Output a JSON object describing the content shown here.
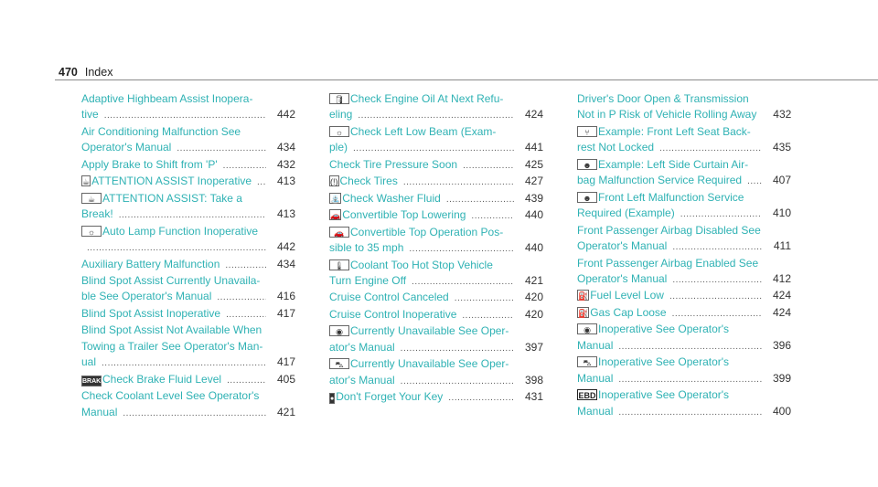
{
  "header": {
    "page_number": "470",
    "section": "Index"
  },
  "columns": [
    [
      {
        "icon": null,
        "lines": [
          "Adaptive Highbeam Assist Inopera-",
          "tive"
        ],
        "page": "442"
      },
      {
        "icon": null,
        "lines": [
          "Air Conditioning Malfunction See",
          "Operator's Manual"
        ],
        "page": "434"
      },
      {
        "icon": null,
        "lines": [
          "Apply Brake to Shift from 'P'"
        ],
        "page": "432"
      },
      {
        "icon": "coffee-cup-icon",
        "glyph": "☕",
        "lines": [
          "ATTENTION ASSIST Inoperative"
        ],
        "page": "413"
      },
      {
        "icon": "coffee-cup-icon",
        "glyph": "☕",
        "lines": [
          "ATTENTION ASSIST: Take a",
          "Break!"
        ],
        "page": "413"
      },
      {
        "icon": "lamp-icon",
        "glyph": "☼",
        "lines": [
          "Auto Lamp Function Inoperative",
          ""
        ],
        "page": "442"
      },
      {
        "icon": null,
        "lines": [
          "Auxiliary Battery Malfunction"
        ],
        "page": "434"
      },
      {
        "icon": null,
        "lines": [
          "Blind Spot Assist Currently Unavaila-",
          "ble See Operator's Manual"
        ],
        "page": "416"
      },
      {
        "icon": null,
        "lines": [
          "Blind Spot Assist Inoperative"
        ],
        "page": "417"
      },
      {
        "icon": null,
        "lines": [
          "Blind Spot Assist Not Available When",
          "Towing a Trailer See Operator's Man-",
          "ual"
        ],
        "page": "417"
      },
      {
        "icon": "brake-icon",
        "glyph": "BRAKE",
        "lines": [
          "Check Brake Fluid Level"
        ],
        "page": "405"
      },
      {
        "icon": null,
        "lines": [
          "Check Coolant Level See Operator's",
          "Manual"
        ],
        "page": "421"
      }
    ],
    [
      {
        "icon": "oil-can-icon",
        "glyph": "🛢",
        "lines": [
          "Check Engine Oil At Next Refu-",
          "eling"
        ],
        "page": "424"
      },
      {
        "icon": "lamp-icon",
        "glyph": "☼",
        "lines": [
          "Check Left Low Beam (Exam-",
          "ple)"
        ],
        "page": "441"
      },
      {
        "icon": null,
        "lines": [
          "Check Tire Pressure Soon"
        ],
        "page": "425"
      },
      {
        "icon": "tire-pressure-icon",
        "glyph": "(!)",
        "lines": [
          "Check Tires"
        ],
        "page": "427"
      },
      {
        "icon": "washer-fluid-icon",
        "glyph": "⛲",
        "lines": [
          "Check Washer Fluid"
        ],
        "page": "439"
      },
      {
        "icon": "convertible-icon",
        "glyph": "🚗",
        "lines": [
          " Convertible Top Lowering"
        ],
        "page": "440"
      },
      {
        "icon": "convertible-icon",
        "glyph": "🚗",
        "lines": [
          " Convertible Top Operation Pos-",
          "sible to 35 mph"
        ],
        "page": "440"
      },
      {
        "icon": "coolant-temp-icon",
        "glyph": "🌡",
        "lines": [
          "Coolant Too Hot Stop Vehicle",
          "Turn Engine Off"
        ],
        "page": "421"
      },
      {
        "icon": null,
        "lines": [
          "Cruise Control Canceled"
        ],
        "page": "420"
      },
      {
        "icon": null,
        "lines": [
          "Cruise Control Inoperative"
        ],
        "page": "420"
      },
      {
        "icon": "abs-icon",
        "glyph": "◉",
        "lines": [
          "Currently Unavailable See Oper-",
          "ator's Manual"
        ],
        "page": "397"
      },
      {
        "icon": "esp-skid-icon",
        "glyph": "⛍",
        "lines": [
          "Currently Unavailable See Oper-",
          "ator's Manual"
        ],
        "page": "398"
      },
      {
        "icon": "key-icon",
        "glyph": "●",
        "lines": [
          "Don't Forget Your Key"
        ],
        "page": "431"
      }
    ],
    [
      {
        "icon": null,
        "lines": [
          "Driver's Door Open & Transmission",
          "Not in P Risk of Vehicle Rolling Away"
        ],
        "page": "432"
      },
      {
        "icon": "seat-backrest-icon",
        "glyph": "⑂",
        "lines": [
          "Example: Front Left Seat Back-",
          "rest Not Locked"
        ],
        "page": "435"
      },
      {
        "icon": "airbag-icon",
        "glyph": "☻",
        "lines": [
          "Example: Left Side Curtain Air-",
          "bag Malfunction Service Required"
        ],
        "page": "407"
      },
      {
        "icon": "airbag-icon",
        "glyph": "☻",
        "lines": [
          "Front Left Malfunction Service",
          "Required (Example)"
        ],
        "page": "410"
      },
      {
        "icon": null,
        "lines": [
          "Front Passenger Airbag Disabled See",
          "Operator's Manual"
        ],
        "page": "411"
      },
      {
        "icon": null,
        "lines": [
          "Front Passenger Airbag Enabled See",
          "Operator's Manual"
        ],
        "page": "412"
      },
      {
        "icon": "fuel-pump-icon",
        "glyph": "⛽",
        "lines": [
          "Fuel Level Low"
        ],
        "page": "424"
      },
      {
        "icon": "fuel-pump-icon",
        "glyph": "⛽",
        "lines": [
          "Gas Cap Loose"
        ],
        "page": "424"
      },
      {
        "icon": "abs-icon",
        "glyph": "◉",
        "lines": [
          "Inoperative See Operator's",
          "Manual"
        ],
        "page": "396"
      },
      {
        "icon": "esp-skid-icon",
        "glyph": "⛍",
        "lines": [
          "Inoperative See Operator's",
          "Manual"
        ],
        "page": "399"
      },
      {
        "icon": "ebd-icon",
        "glyph": "EBD",
        "lines": [
          "Inoperative See Operator's",
          "Manual"
        ],
        "page": "400"
      }
    ]
  ],
  "colors": {
    "entry_text": "#2fb2b4",
    "page_number": "#333333",
    "rule": "#8a8a8a"
  }
}
